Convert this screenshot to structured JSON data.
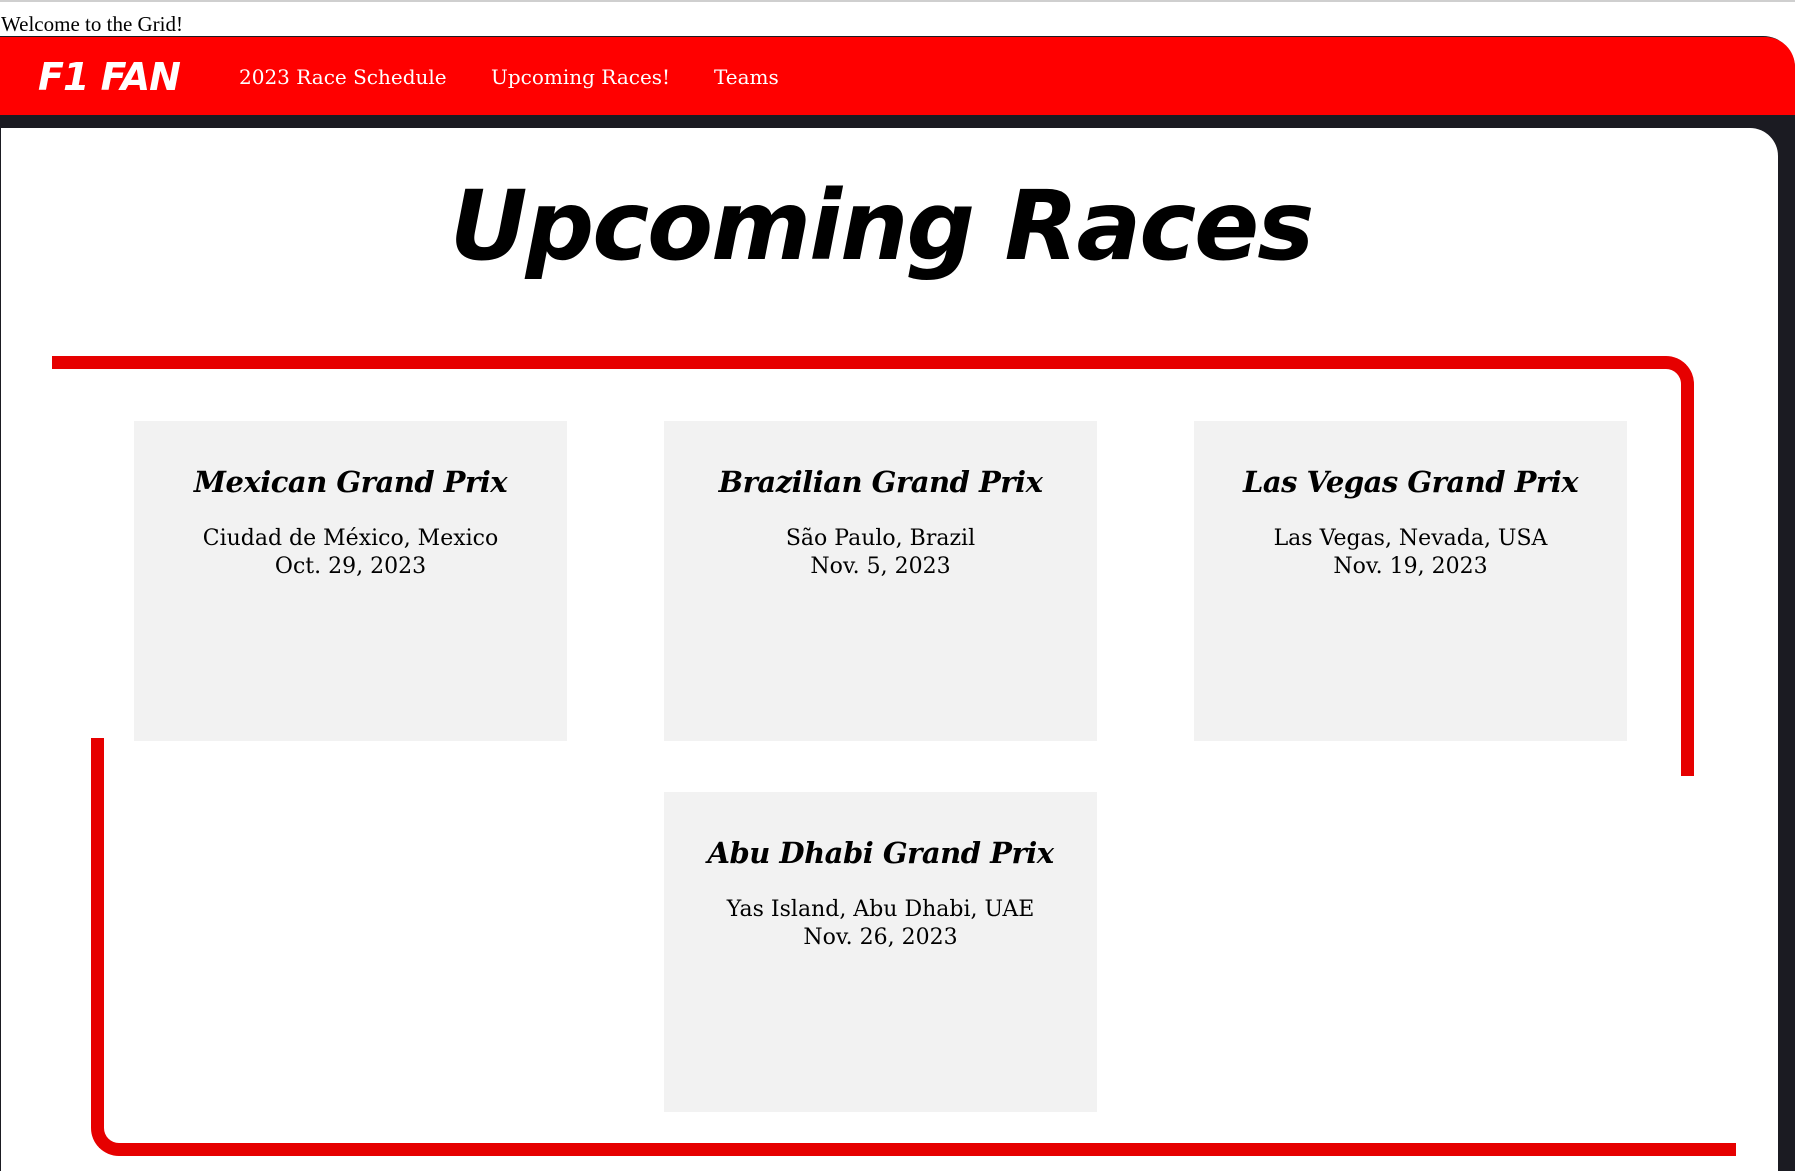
{
  "welcome_text": "Welcome to the Grid!",
  "nav": {
    "logo": "F1 FAN",
    "links": [
      "2023 Race Schedule",
      "Upcoming Races!",
      "Teams"
    ]
  },
  "main": {
    "title": "Upcoming Races",
    "races": [
      {
        "name": "Mexican Grand Prix",
        "location": "Ciudad de México, Mexico",
        "date": "Oct. 29, 2023"
      },
      {
        "name": "Brazilian Grand Prix",
        "location": "São Paulo, Brazil",
        "date": "Nov. 5, 2023"
      },
      {
        "name": "Las Vegas Grand Prix",
        "location": "Las Vegas, Nevada, USA",
        "date": "Nov. 19, 2023"
      },
      {
        "name": "Abu Dhabi Grand Prix",
        "location": "Yas Island, Abu Dhabi, UAE",
        "date": "Nov. 26, 2023"
      }
    ]
  },
  "colors": {
    "navbar": "#ff0000",
    "track": "#e60000",
    "frame": "#1b1b22",
    "card": "#f2f2f2"
  }
}
